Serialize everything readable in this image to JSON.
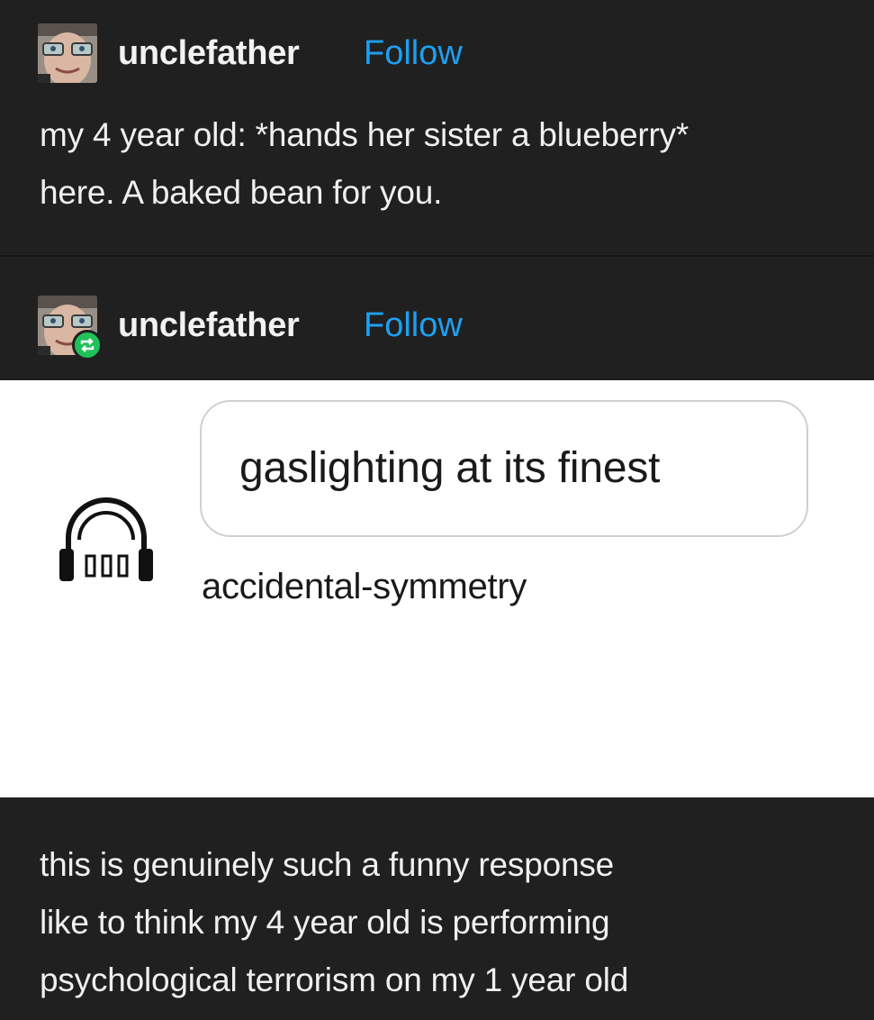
{
  "original_post": {
    "username": "unclefather",
    "follow_label": "Follow",
    "text_lines": [
      "my 4 year old: *hands her sister a blueberry*",
      "here. A baked bean for you."
    ]
  },
  "reblog_post": {
    "username": "unclefather",
    "follow_label": "Follow",
    "embedded_image": {
      "bubble_text": "gaslighting at its finest",
      "username": "accidental-symmetry",
      "icon": "headphones-icon"
    },
    "text_lines": [
      "this is genuinely such a funny response",
      "like to think my 4 year old is performing",
      "psychological terrorism on my 1 year old"
    ]
  },
  "colors": {
    "background": "#202020",
    "text": "#f0f0f0",
    "follow": "#1ea0f0",
    "reblog_badge": "#20c15a"
  }
}
